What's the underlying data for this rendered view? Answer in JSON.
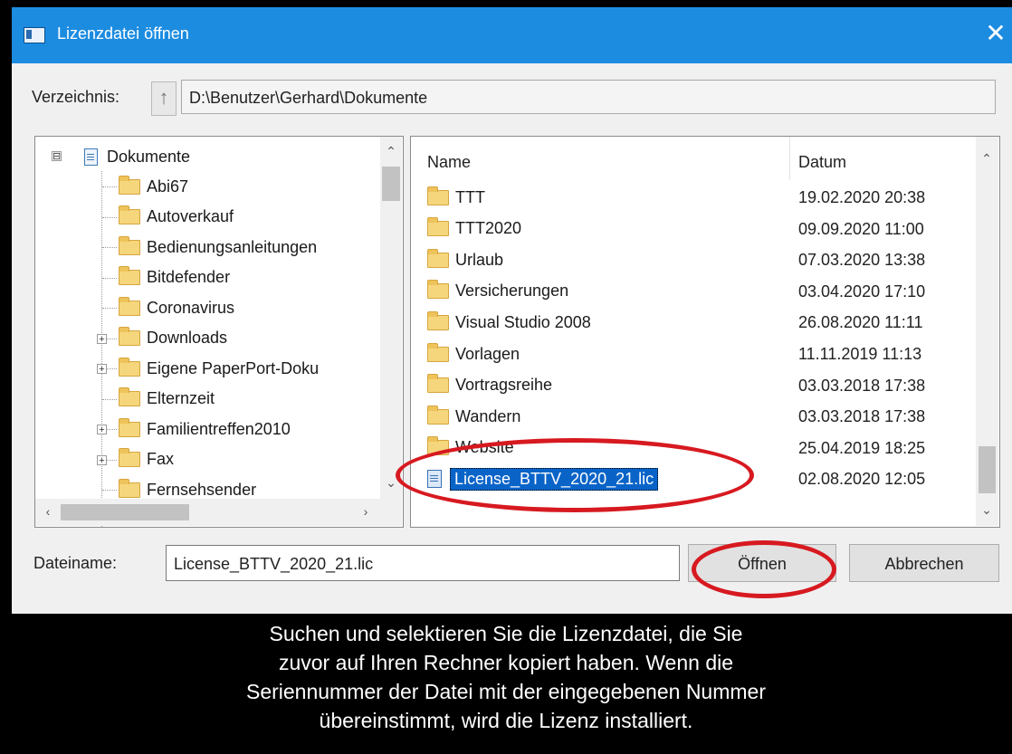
{
  "dialog": {
    "title": "Lizenzdatei öffnen",
    "close_label": "✕"
  },
  "directory": {
    "label": "Verzeichnis:",
    "up_glyph": "↑",
    "path": "D:\\Benutzer\\Gerhard\\Dokumente"
  },
  "tree": {
    "root": {
      "label": "Dokumente",
      "expander": "⊟"
    },
    "items": [
      {
        "label": "Abi67",
        "expandable": false
      },
      {
        "label": "Autoverkauf",
        "expandable": false
      },
      {
        "label": "Bedienungsanleitungen",
        "expandable": false
      },
      {
        "label": "Bitdefender",
        "expandable": false
      },
      {
        "label": "Coronavirus",
        "expandable": false
      },
      {
        "label": "Downloads",
        "expandable": true
      },
      {
        "label": "Eigene PaperPort-Doku",
        "expandable": true
      },
      {
        "label": "Elternzeit",
        "expandable": false
      },
      {
        "label": "Familientreffen2010",
        "expandable": true
      },
      {
        "label": "Fax",
        "expandable": true
      },
      {
        "label": "Fernsehsender",
        "expandable": false
      }
    ]
  },
  "files": {
    "headers": {
      "name": "Name",
      "date": "Datum"
    },
    "rows": [
      {
        "name": "TTT",
        "date": "19.02.2020 20:38",
        "type": "folder"
      },
      {
        "name": "TTT2020",
        "date": "09.09.2020 11:00",
        "type": "folder"
      },
      {
        "name": "Urlaub",
        "date": "07.03.2020 13:38",
        "type": "folder"
      },
      {
        "name": "Versicherungen",
        "date": "03.04.2020 17:10",
        "type": "folder"
      },
      {
        "name": "Visual Studio 2008",
        "date": "26.08.2020 11:11",
        "type": "folder"
      },
      {
        "name": "Vorlagen",
        "date": "11.11.2019 11:13",
        "type": "folder"
      },
      {
        "name": "Vortragsreihe",
        "date": "03.03.2018 17:38",
        "type": "folder"
      },
      {
        "name": "Wandern",
        "date": "03.03.2018 17:38",
        "type": "folder"
      },
      {
        "name": "Website",
        "date": "25.04.2019 18:25",
        "type": "folder"
      },
      {
        "name": "License_BTTV_2020_21.lic",
        "date": "02.08.2020 12:05",
        "type": "file",
        "selected": true
      }
    ]
  },
  "footer": {
    "filename_label": "Dateiname:",
    "filename_value": "License_BTTV_2020_21.lic",
    "open_label": "Öffnen",
    "cancel_label": "Abbrechen"
  },
  "caption": {
    "lines": [
      "Suchen und selektieren Sie die Lizenzdatei, die Sie",
      "zuvor auf Ihren Rechner kopiert haben. Wenn die",
      "Seriennummer der Datei mit der eingegebenen Nummer",
      "übereinstimmt, wird die Lizenz installiert."
    ]
  },
  "colors": {
    "titlebar": "#1c8ce1",
    "highlight": "#0a64c8",
    "annotation_red": "#d71920"
  }
}
